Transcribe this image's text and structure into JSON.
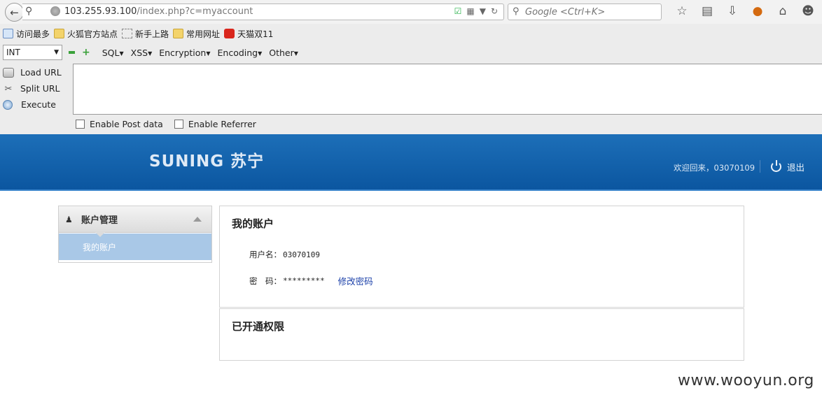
{
  "browser": {
    "url_host": "103.255.93.100",
    "url_path": "/index.php?c=myaccount",
    "search_placeholder": "Google <Ctrl+K>",
    "bookmarks": [
      {
        "label": "访问最多",
        "icon": "most-visited-icon"
      },
      {
        "label": "火狐官方站点",
        "icon": "folder-icon"
      },
      {
        "label": "新手上路",
        "icon": "page-icon"
      },
      {
        "label": "常用网址",
        "icon": "folder-icon"
      },
      {
        "label": "天猫双11",
        "icon": "tmall-icon"
      }
    ]
  },
  "hackbar": {
    "select_value": "INT",
    "menus": [
      "SQL",
      "XSS",
      "Encryption",
      "Encoding",
      "Other"
    ],
    "load_url": "Load URL",
    "split_url": "Split URL",
    "execute": "Execute",
    "enable_post": "Enable Post data",
    "enable_referrer": "Enable Referrer"
  },
  "site": {
    "logo": "SUNING 苏宁",
    "welcome": "欢迎回来，03070109",
    "logout": "退出",
    "brand_color": "#0f5ea8"
  },
  "sidebar": {
    "section_title": "账户管理",
    "items": [
      {
        "label": "我的账户"
      }
    ]
  },
  "account": {
    "title": "我的账户",
    "username_label": "用户名：",
    "username_value": "03070109",
    "password_label": "密　码：",
    "password_value": "*********",
    "change_password": "修改密码"
  },
  "permissions": {
    "title": "已开通权限"
  },
  "watermark": "www.wooyun.org"
}
